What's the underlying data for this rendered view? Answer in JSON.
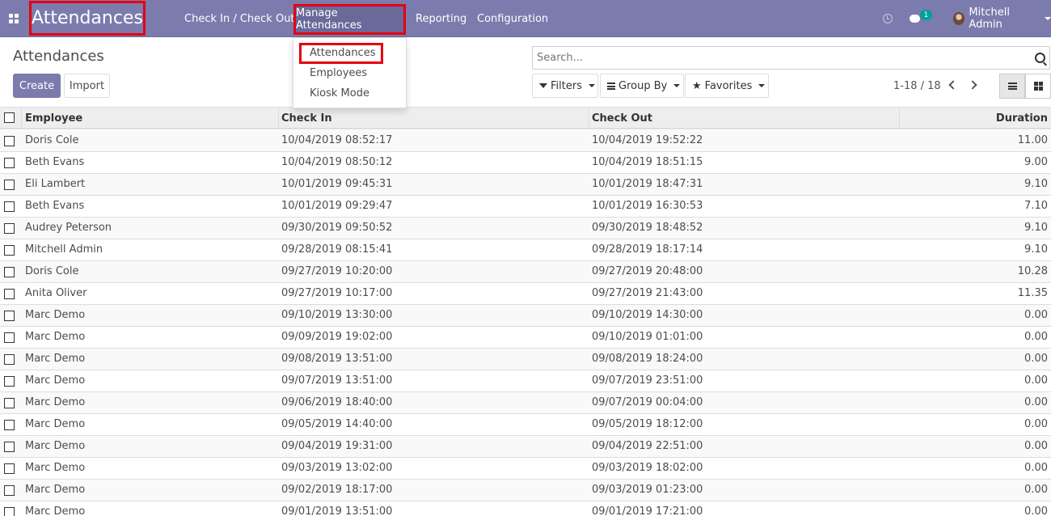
{
  "navbar": {
    "app_title": "Attendances",
    "menus": [
      "Check In / Check Out",
      "Manage Attendances",
      "Reporting",
      "Configuration"
    ],
    "chat_count": "1",
    "user_name": "Mitchell Admin",
    "accent_color": "#7c7bad",
    "highlight_color": "#e5000f"
  },
  "dropdown": {
    "items": [
      "Attendances",
      "Employees",
      "Kiosk Mode"
    ]
  },
  "control_panel": {
    "breadcrumb": "Attendances",
    "create_label": "Create",
    "import_label": "Import",
    "search_placeholder": "Search...",
    "filters_label": "Filters",
    "group_by_label": "Group By",
    "favorites_label": "Favorites",
    "pager": "1-18 / 18"
  },
  "table": {
    "columns": [
      "Employee",
      "Check In",
      "Check Out",
      "Duration"
    ],
    "rows": [
      {
        "employee": "Doris Cole",
        "check_in": "10/04/2019 08:52:17",
        "check_out": "10/04/2019 19:52:22",
        "duration": "11.00"
      },
      {
        "employee": "Beth Evans",
        "check_in": "10/04/2019 08:50:12",
        "check_out": "10/04/2019 18:51:15",
        "duration": "9.00"
      },
      {
        "employee": "Eli Lambert",
        "check_in": "10/01/2019 09:45:31",
        "check_out": "10/01/2019 18:47:31",
        "duration": "9.10"
      },
      {
        "employee": "Beth Evans",
        "check_in": "10/01/2019 09:29:47",
        "check_out": "10/01/2019 16:30:53",
        "duration": "7.10"
      },
      {
        "employee": "Audrey Peterson",
        "check_in": "09/30/2019 09:50:52",
        "check_out": "09/30/2019 18:48:52",
        "duration": "9.10"
      },
      {
        "employee": "Mitchell Admin",
        "check_in": "09/28/2019 08:15:41",
        "check_out": "09/28/2019 18:17:14",
        "duration": "9.10"
      },
      {
        "employee": "Doris Cole",
        "check_in": "09/27/2019 10:20:00",
        "check_out": "09/27/2019 20:48:00",
        "duration": "10.28"
      },
      {
        "employee": "Anita Oliver",
        "check_in": "09/27/2019 10:17:00",
        "check_out": "09/27/2019 21:43:00",
        "duration": "11.35"
      },
      {
        "employee": "Marc Demo",
        "check_in": "09/10/2019 13:30:00",
        "check_out": "09/10/2019 14:30:00",
        "duration": "0.00"
      },
      {
        "employee": "Marc Demo",
        "check_in": "09/09/2019 19:02:00",
        "check_out": "09/10/2019 01:01:00",
        "duration": "0.00"
      },
      {
        "employee": "Marc Demo",
        "check_in": "09/08/2019 13:51:00",
        "check_out": "09/08/2019 18:24:00",
        "duration": "0.00"
      },
      {
        "employee": "Marc Demo",
        "check_in": "09/07/2019 13:51:00",
        "check_out": "09/07/2019 23:51:00",
        "duration": "0.00"
      },
      {
        "employee": "Marc Demo",
        "check_in": "09/06/2019 18:40:00",
        "check_out": "09/07/2019 00:04:00",
        "duration": "0.00"
      },
      {
        "employee": "Marc Demo",
        "check_in": "09/05/2019 14:40:00",
        "check_out": "09/05/2019 18:12:00",
        "duration": "0.00"
      },
      {
        "employee": "Marc Demo",
        "check_in": "09/04/2019 19:31:00",
        "check_out": "09/04/2019 22:51:00",
        "duration": "0.00"
      },
      {
        "employee": "Marc Demo",
        "check_in": "09/03/2019 13:02:00",
        "check_out": "09/03/2019 18:02:00",
        "duration": "0.00"
      },
      {
        "employee": "Marc Demo",
        "check_in": "09/02/2019 18:17:00",
        "check_out": "09/03/2019 01:23:00",
        "duration": "0.00"
      },
      {
        "employee": "Marc Demo",
        "check_in": "09/01/2019 13:51:00",
        "check_out": "09/01/2019 17:21:00",
        "duration": "0.00"
      }
    ]
  }
}
